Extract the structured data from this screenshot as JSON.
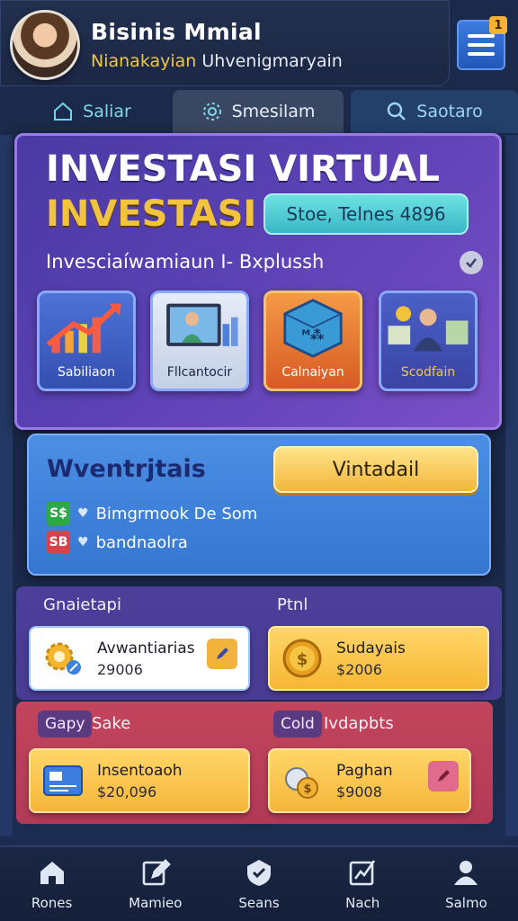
{
  "header": {
    "title": "Bisinis Mmial",
    "subtitle_highlight": "Nianakayian",
    "subtitle_rest": "Uhvenigmaryain",
    "menu_badge": "1"
  },
  "tabs": [
    {
      "label": "Saliar",
      "icon": "home-icon"
    },
    {
      "label": "Smesilam",
      "icon": "gear-icon"
    },
    {
      "label": "Saotaro",
      "icon": "search-icon"
    }
  ],
  "main": {
    "title": "INVESTASI VIRTUAL",
    "subtitle": "INVESTASI",
    "stats_pill": "Stoe, Telnes 4896",
    "description": "Invesciaíwamiaun I- Bxplussh",
    "features": [
      {
        "label": "Sabiliaon",
        "icon": "growth-chart-icon"
      },
      {
        "label": "Fllcantocir",
        "icon": "computer-user-icon"
      },
      {
        "label": "Calnaiyan",
        "icon": "cube-icon"
      },
      {
        "label": "Scodfain",
        "icon": "businessman-money-icon"
      }
    ]
  },
  "virtual": {
    "title": "Wventrjtais",
    "button": "Vintadail",
    "lines": [
      {
        "badge": "S$",
        "text": "Bimgrmook De Som"
      },
      {
        "badge": "SB",
        "text": "bandnaolra"
      }
    ]
  },
  "section1": {
    "label_left": "Gnaietapi",
    "label_right": "Ptnl",
    "cards": [
      {
        "name": "Avwantiarias",
        "value": "29006",
        "icon": "gear-coin-icon"
      },
      {
        "name": "Sudayais",
        "value": "$2006",
        "icon": "gold-coin-icon"
      }
    ]
  },
  "section2": {
    "tag_left": "Gapy",
    "label_left": "Sake",
    "tag_right": "Cold",
    "label_right": "Ivdapbts",
    "cards": [
      {
        "name": "Insentoaoh",
        "value": "$20,096",
        "icon": "certificate-icon"
      },
      {
        "name": "Paghan",
        "value": "$9008",
        "icon": "coin-bag-icon"
      }
    ]
  },
  "bottom_nav": [
    {
      "label": "Rones",
      "icon": "home-icon"
    },
    {
      "label": "Mamieo",
      "icon": "edit-icon"
    },
    {
      "label": "Seans",
      "icon": "shield-icon"
    },
    {
      "label": "Nach",
      "icon": "chart-edit-icon"
    },
    {
      "label": "Salmo",
      "icon": "user-icon"
    }
  ],
  "colors": {
    "background": "#1b2a4a",
    "accent_gold": "#f2c43d",
    "main_card": "#5a41b4",
    "virtual_card": "#3d80d8",
    "section_red": "#b93f59"
  }
}
